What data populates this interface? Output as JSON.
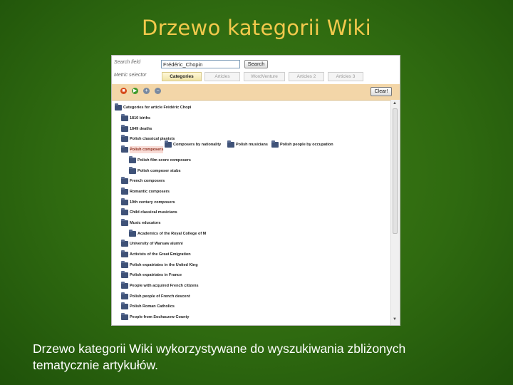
{
  "slide": {
    "title": "Drzewo kategorii Wiki",
    "caption": "Drzewo kategorii Wiki wykorzystywane do wyszukiwania zbliżonych tematycznie artykułów."
  },
  "app": {
    "search_field_label": "Search field",
    "search_value": "Frédéric_Chopin",
    "search_button": "Search",
    "metric_selector_label": "Metric selector",
    "metric_tabs": [
      {
        "label": "Categories",
        "active": true
      },
      {
        "label": "Articles",
        "active": false
      },
      {
        "label": "WordVenture",
        "active": false
      },
      {
        "label": "Articles 2",
        "active": false
      },
      {
        "label": "Articles 3",
        "active": false
      }
    ],
    "clear_button": "Clear!",
    "toolbar_icons": [
      "stop-icon",
      "forward-icon",
      "zoom-in-icon",
      "zoom-out-icon"
    ],
    "tree": {
      "root": "Categories for article Frédéric Chopi",
      "items": [
        "1810 births",
        "1849 deaths",
        "Polish classical pianists",
        "Polish composers",
        "Polish film score composers",
        "Polish composer stubs",
        "French composers",
        "Romantic composers",
        "19th century composers",
        "Child classical musicians",
        "Music educators",
        "Academics of the Royal College of M",
        "University of Warsaw alumni",
        "Activists of the Great Emigration",
        "Polish expatriates in the United King",
        "Polish expatriates in France",
        "People with acquired French citizens",
        "Polish people of French descent",
        "Polish Roman Catholics",
        "People from Sochaczew County"
      ],
      "side_nodes": [
        "Composers by nationality",
        "Polish musicians",
        "Polish people by occupation"
      ]
    }
  }
}
